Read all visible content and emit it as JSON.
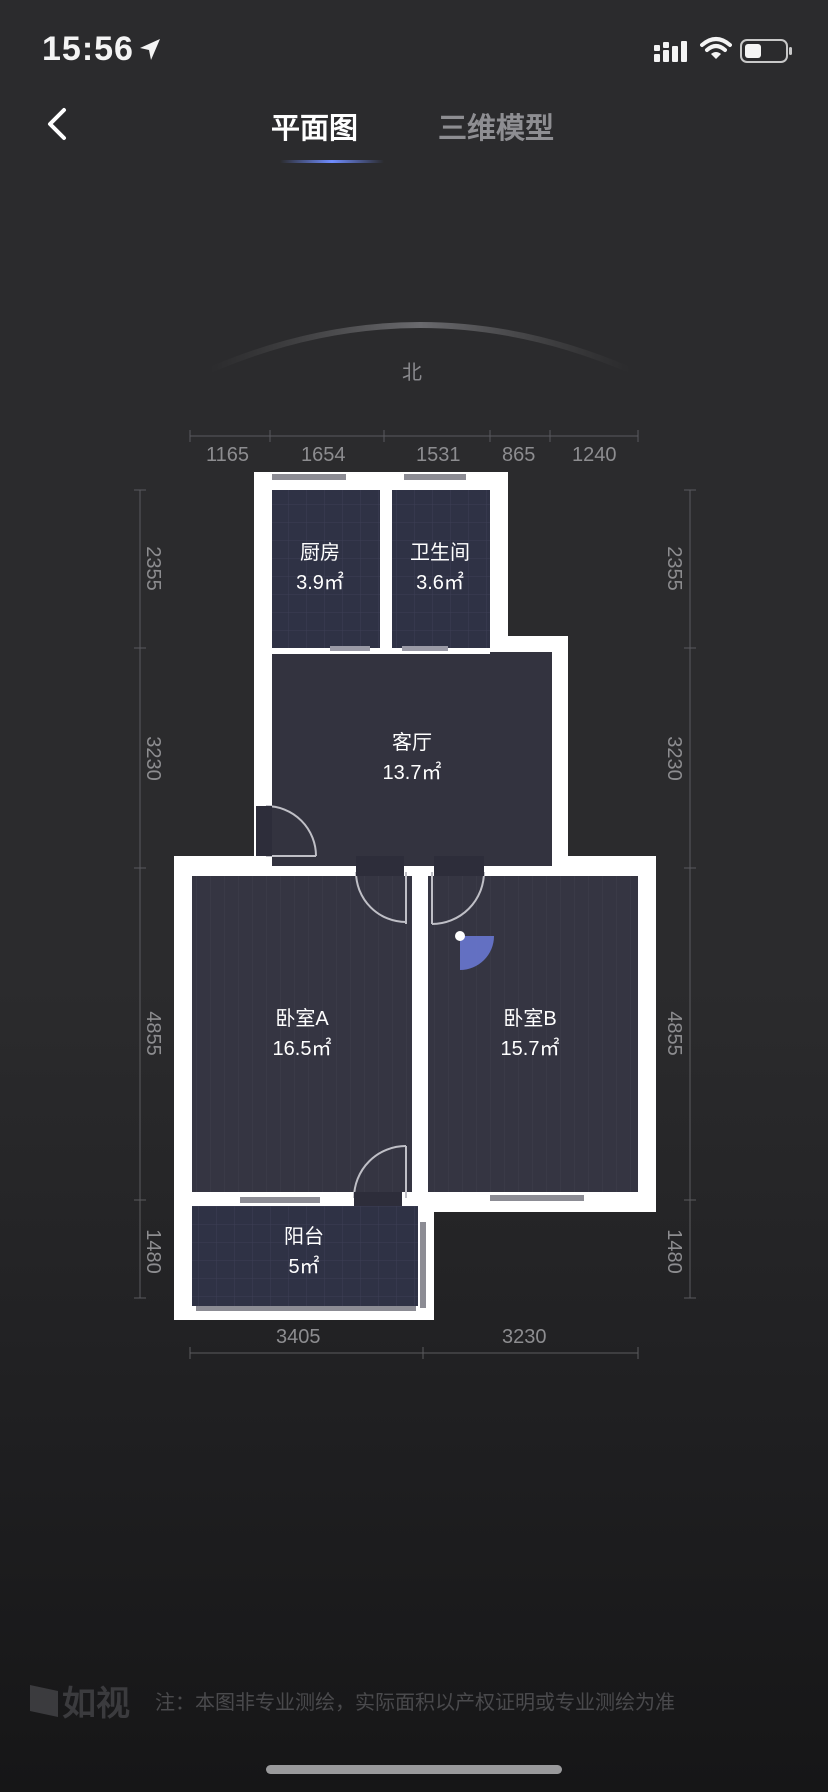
{
  "status_bar": {
    "time": "15:56"
  },
  "header": {
    "tabs": [
      {
        "label": "平面图",
        "active": true
      },
      {
        "label": "三维模型",
        "active": false
      }
    ]
  },
  "compass": {
    "label": "北"
  },
  "dimensions": {
    "top": [
      "1165",
      "1654",
      "1531",
      "865",
      "1240"
    ],
    "bottom": [
      "3405",
      "3230"
    ],
    "left": [
      "2355",
      "3230",
      "4855",
      "1480"
    ],
    "right": [
      "2355",
      "3230",
      "4855",
      "1480"
    ]
  },
  "rooms": [
    {
      "name": "厨房",
      "area": "3.9㎡"
    },
    {
      "name": "卫生间",
      "area": "3.6㎡"
    },
    {
      "name": "客厅",
      "area": "13.7㎡"
    },
    {
      "name": "卧室A",
      "area": "16.5㎡"
    },
    {
      "name": "卧室B",
      "area": "15.7㎡"
    },
    {
      "name": "阳台",
      "area": "5㎡"
    }
  ],
  "footer": {
    "logo": "如视",
    "note": "注：本图非专业测绘，实际面积以产权证明或专业测绘为准"
  },
  "colors": {
    "accent": "#6f8cff",
    "room_fill": "#353542",
    "wall": "#ffffff"
  }
}
